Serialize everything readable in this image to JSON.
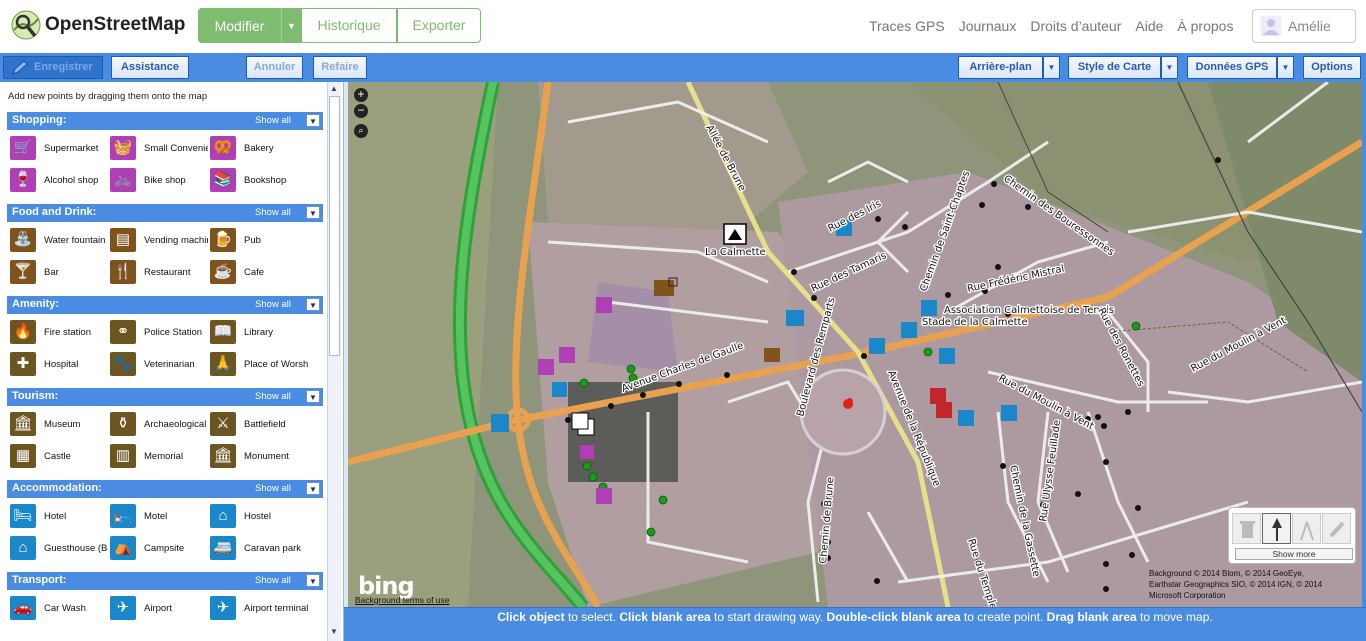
{
  "header": {
    "site_title": "OpenStreetMap",
    "edit_label": "Modifier",
    "history_label": "Historique",
    "export_label": "Exporter",
    "nav": [
      "Traces GPS",
      "Journaux",
      "Droits d’auteur",
      "Aide",
      "À propos"
    ],
    "user_name": "Amélie"
  },
  "toolbar": {
    "save": "Enregistrer",
    "assist": "Assistance",
    "undo": "Annuler",
    "redo": "Refaire",
    "background": "Arrière-plan",
    "map_style": "Style de Carte",
    "gps_data": "Données GPS",
    "options": "Options"
  },
  "sidebar": {
    "tip": "Add new points by dragging them onto the map",
    "show_all": "Show all",
    "categories": [
      {
        "title": "Shopping:",
        "items": [
          {
            "label": "Supermarket",
            "icon": "cart-icon",
            "glyph": "🛒"
          },
          {
            "label": "Small Convenience",
            "icon": "basket-icon",
            "glyph": "🧺"
          },
          {
            "label": "Bakery",
            "icon": "pretzel-icon",
            "glyph": "🥨"
          },
          {
            "label": "Alcohol shop",
            "icon": "bottle-icon",
            "glyph": "🍷"
          },
          {
            "label": "Bike shop",
            "icon": "bicycle-icon",
            "glyph": "🚲"
          },
          {
            "label": "Bookshop",
            "icon": "book-icon",
            "glyph": "📚"
          }
        ]
      },
      {
        "title": "Food and Drink:",
        "items": [
          {
            "label": "Water fountain",
            "icon": "fountain-icon",
            "glyph": "⛲"
          },
          {
            "label": "Vending machine",
            "icon": "vending-icon",
            "glyph": "▤"
          },
          {
            "label": "Pub",
            "icon": "pint-icon",
            "glyph": "🍺"
          },
          {
            "label": "Bar",
            "icon": "cocktail-icon",
            "glyph": "🍸"
          },
          {
            "label": "Restaurant",
            "icon": "cutlery-icon",
            "glyph": "🍴"
          },
          {
            "label": "Cafe",
            "icon": "cup-icon",
            "glyph": "☕"
          }
        ]
      },
      {
        "title": "Amenity:",
        "items": [
          {
            "label": "Fire station",
            "icon": "fire-icon",
            "glyph": "🔥"
          },
          {
            "label": "Police Station",
            "icon": "handcuffs-icon",
            "glyph": "⚭"
          },
          {
            "label": "Library",
            "icon": "library-icon",
            "glyph": "📖"
          },
          {
            "label": "Hospital",
            "icon": "hospital-icon",
            "glyph": "✚"
          },
          {
            "label": "Veterinarian",
            "icon": "paw-icon",
            "glyph": "🐾"
          },
          {
            "label": "Place of Worship",
            "icon": "worship-icon",
            "glyph": "🙏"
          }
        ]
      },
      {
        "title": "Tourism:",
        "items": [
          {
            "label": "Museum",
            "icon": "museum-icon",
            "glyph": "🏛"
          },
          {
            "label": "Archaeological site",
            "icon": "amphora-icon",
            "glyph": "⚱"
          },
          {
            "label": "Battlefield",
            "icon": "swords-icon",
            "glyph": "⚔"
          },
          {
            "label": "Castle",
            "icon": "castle-icon",
            "glyph": "▦"
          },
          {
            "label": "Memorial",
            "icon": "memorial-icon",
            "glyph": "▥"
          },
          {
            "label": "Monument",
            "icon": "monument-icon",
            "glyph": "🏛"
          }
        ]
      },
      {
        "title": "Accommodation:",
        "items": [
          {
            "label": "Hotel",
            "icon": "hotel-icon",
            "glyph": "🛏"
          },
          {
            "label": "Motel",
            "icon": "motel-icon",
            "glyph": "🛌"
          },
          {
            "label": "Hostel",
            "icon": "hostel-icon",
            "glyph": "⌂"
          },
          {
            "label": "Guesthouse (B&B)",
            "icon": "guesthouse-icon",
            "glyph": "⌂"
          },
          {
            "label": "Campsite",
            "icon": "tent-icon",
            "glyph": "⛺"
          },
          {
            "label": "Caravan park",
            "icon": "caravan-icon",
            "glyph": "🚐"
          }
        ]
      },
      {
        "title": "Transport:",
        "items": [
          {
            "label": "Car Wash",
            "icon": "car-wash-icon",
            "glyph": "🚗"
          },
          {
            "label": "Airport",
            "icon": "airplane-icon",
            "glyph": "✈"
          },
          {
            "label": "Airport terminal",
            "icon": "terminal-icon",
            "glyph": "✈"
          }
        ]
      }
    ]
  },
  "map": {
    "labels": {
      "allee": "Allée de Brune",
      "iris": "Rue des Iris",
      "tamaris": "Rue des Tamaris",
      "calmette": "La Calmette",
      "saint_chaptes": "Chemin de Saint-Chaptes",
      "bouressonnes": "Chemin des Bouressonnes",
      "mistral": "Rue Frédéric Mistral",
      "asso1": "Association Calmettoise de Tennis",
      "asso2": "Stade de la Calmette",
      "ronettes": "Rue des Ronettes",
      "moulin_vent": "Rue du Moulin à Vent",
      "charles": "Avenue Charles de Gaulle",
      "remparts": "Boulevard des Remparts",
      "republique": "Avenue de la République",
      "moulin2": "Rue du Moulin à Vent",
      "feuillade": "Rue Ulysse Feuillade",
      "gassette": "Chemin de la Gassette",
      "brune": "Chemin de Brune",
      "temple": "Rue du Temple"
    },
    "bing": "bing",
    "terms": "Background terms of use",
    "attribution": [
      "Background © 2014 Blom, © 2014 GeoEye,",
      "Earthstar Geographics SIO, © 2014 IGN, © 2014",
      "Microsoft Corporation"
    ],
    "show_more": "Show more"
  },
  "status": {
    "parts": [
      {
        "b": "Click object",
        "t": " to select. "
      },
      {
        "b": "Click blank area",
        "t": " to start drawing way. "
      },
      {
        "b": "Double-click blank area",
        "t": " to create point. "
      },
      {
        "b": "Drag blank area",
        "t": " to move map."
      }
    ]
  },
  "colors": {
    "osm_green": "#7ebc6f",
    "toolbar_blue": "#4a8ce2",
    "shop_purple": "#b03fb5",
    "food_brown": "#80531d",
    "transport_blue": "#1a88c8"
  }
}
